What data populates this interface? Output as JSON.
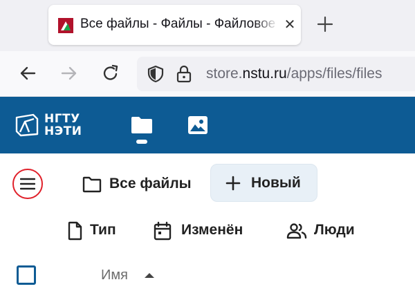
{
  "browser": {
    "tab": {
      "title": "Все файлы - Файлы - Файловое хранилище",
      "close": "✕"
    },
    "url": {
      "prefix": "store.",
      "host": "nstu.ru",
      "path": "/apps/files/files"
    }
  },
  "app": {
    "logo": {
      "line1": "НГТУ",
      "line2": "НЭТИ"
    },
    "nav": {
      "active": "files"
    }
  },
  "breadcrumb": {
    "label": "Все файлы"
  },
  "new_button": {
    "label": "Новый"
  },
  "filters": [
    {
      "label": "Тип",
      "icon": "file-icon"
    },
    {
      "label": "Изменён",
      "icon": "calendar-icon"
    },
    {
      "label": "Люди",
      "icon": "people-icon"
    }
  ],
  "table": {
    "column_name": "Имя",
    "sort": "ascending"
  },
  "colors": {
    "brand": "#0d5b94",
    "highlight": "#e0202a",
    "new_button_bg": "#e8f0f7"
  }
}
